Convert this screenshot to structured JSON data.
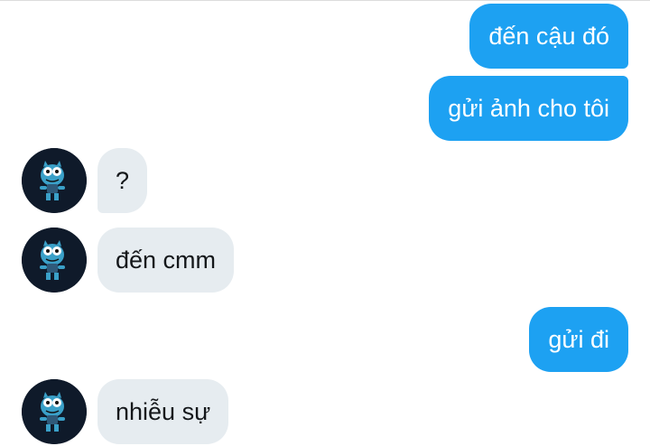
{
  "conversation": {
    "messages": [
      {
        "from": "me",
        "text": "đến cậu đó"
      },
      {
        "from": "me",
        "text": "gửi ảnh cho tôi"
      },
      {
        "from": "them",
        "text": "?"
      },
      {
        "from": "them",
        "text": "đến cmm"
      },
      {
        "from": "me",
        "text": "gửi đi"
      },
      {
        "from": "them",
        "text": "nhiễu sự"
      }
    ],
    "avatar_icon": "cartoon-cat-avatar-icon"
  },
  "colors": {
    "sent_bubble": "#1da1f2",
    "sent_text": "#ffffff",
    "received_bubble": "#e6ecf0",
    "received_text": "#14171a",
    "avatar_bg": "#0f1a2a"
  }
}
